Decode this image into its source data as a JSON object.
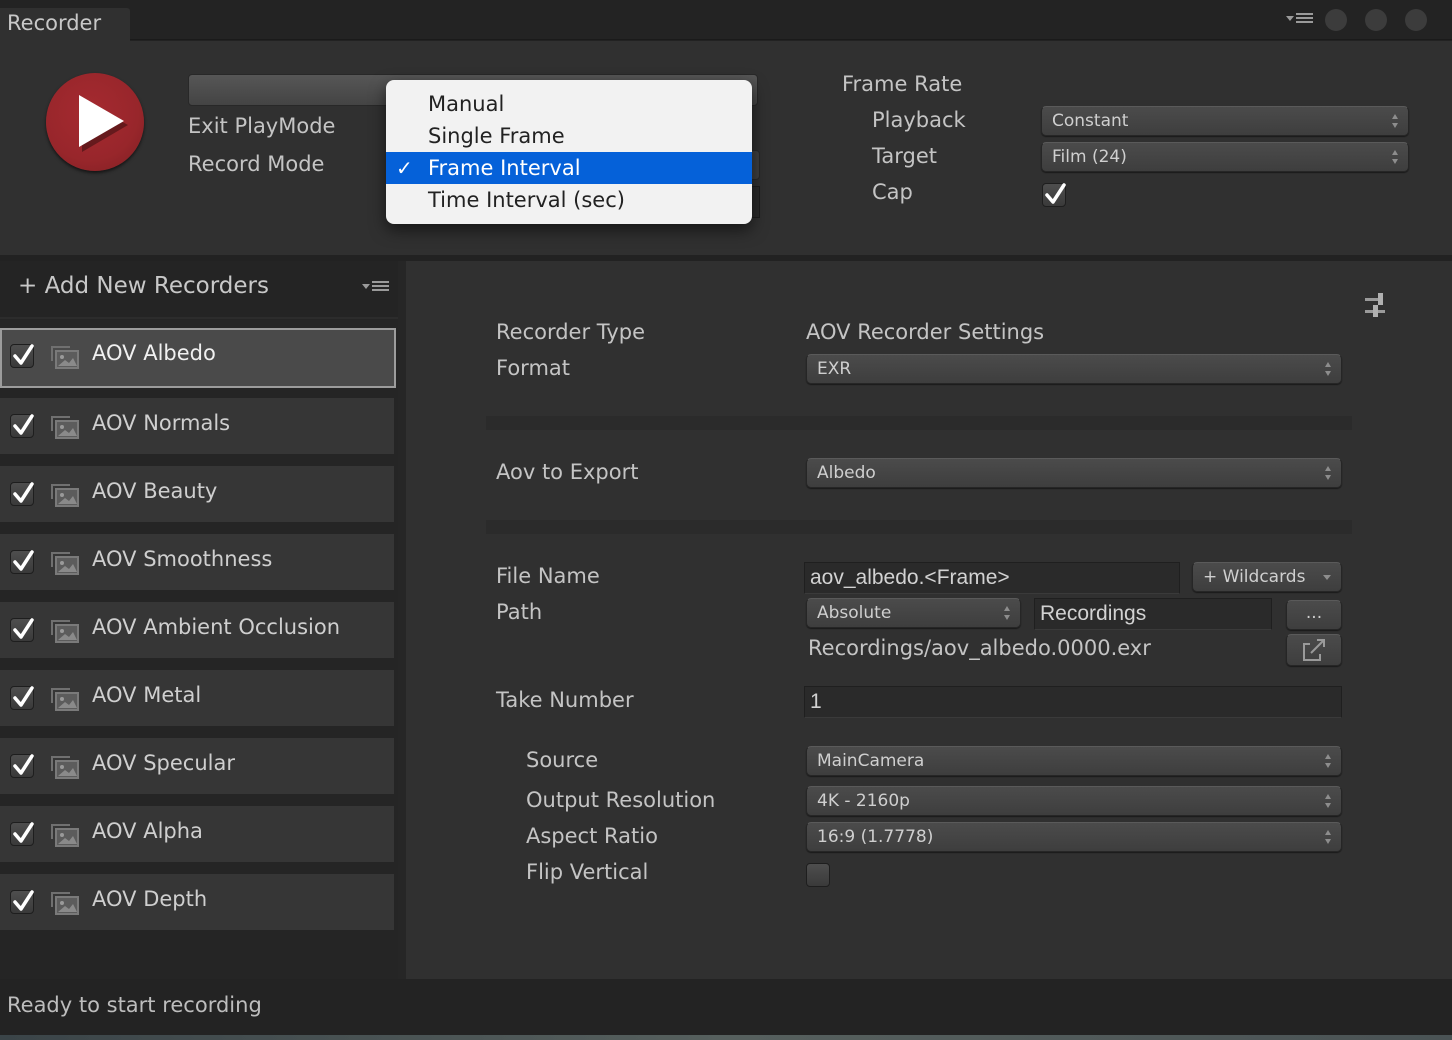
{
  "window": {
    "tab_title": "Recorder"
  },
  "top": {
    "start_button_label": "Start Recording",
    "exit_playmode_label": "Exit PlayMode",
    "record_mode_label": "Record Mode",
    "record_mode_dropdown": {
      "options": [
        "Manual",
        "Single Frame",
        "Frame Interval",
        "Time Interval (sec)"
      ],
      "selected": "Frame Interval",
      "check_glyph": "✓"
    },
    "frame_rate": {
      "title": "Frame Rate",
      "playback_label": "Playback",
      "playback_value": "Constant",
      "target_label": "Target",
      "target_value": "Film (24)",
      "cap_label": "Cap",
      "cap_checked": true
    }
  },
  "recorder_list": {
    "add_label": "+ Add New Recorders",
    "items": [
      {
        "label": "AOV Albedo",
        "enabled": true,
        "selected": true
      },
      {
        "label": "AOV Normals",
        "enabled": true,
        "selected": false
      },
      {
        "label": "AOV Beauty",
        "enabled": true,
        "selected": false
      },
      {
        "label": "AOV Smoothness",
        "enabled": true,
        "selected": false
      },
      {
        "label": "AOV Ambient Occlusion",
        "enabled": true,
        "selected": false
      },
      {
        "label": "AOV Metal",
        "enabled": true,
        "selected": false
      },
      {
        "label": "AOV Specular",
        "enabled": true,
        "selected": false
      },
      {
        "label": "AOV Alpha",
        "enabled": true,
        "selected": false
      },
      {
        "label": "AOV Depth",
        "enabled": true,
        "selected": false
      }
    ]
  },
  "settings": {
    "recorder_type_label": "Recorder Type",
    "recorder_type_value": "AOV Recorder Settings",
    "format_label": "Format",
    "format_value": "EXR",
    "aov_label": "Aov to Export",
    "aov_value": "Albedo",
    "file_name_label": "File Name",
    "file_name_value": "aov_albedo.<Frame>",
    "wildcards_label": "+ Wildcards",
    "path_label": "Path",
    "path_mode": "Absolute",
    "path_value": "Recordings",
    "browse_label": "...",
    "output_preview": "Recordings/aov_albedo.0000.exr",
    "take_number_label": "Take Number",
    "take_number_value": "1",
    "source_label": "Source",
    "source_value": "MainCamera",
    "output_resolution_label": "Output Resolution",
    "output_resolution_value": "4K - 2160p",
    "aspect_ratio_label": "Aspect Ratio",
    "aspect_ratio_value": "16:9 (1.7778)",
    "flip_vertical_label": "Flip Vertical",
    "flip_vertical_checked": false
  },
  "status": {
    "text": "Ready to start recording"
  },
  "colors": {
    "record_red": "#98262b",
    "selection_blue": "#0561d9",
    "panel_bg": "#303030"
  }
}
